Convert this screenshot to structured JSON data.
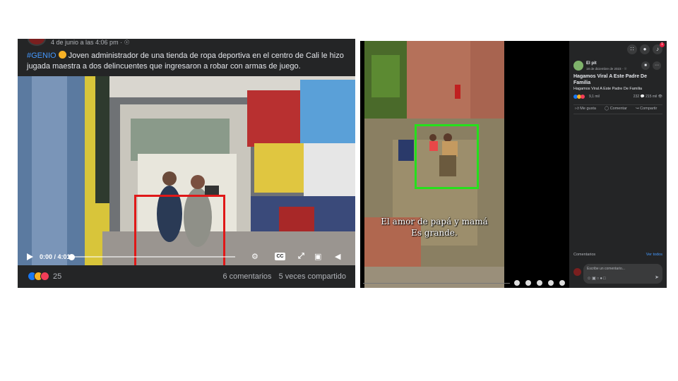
{
  "left_post": {
    "meta": "4 de junio a las 4:06 pm · ",
    "caption_tag": "#GENIO",
    "caption_text": " Joven administrador de una tienda de ropa deportiva en el centro de Cali le hizo jugada maestra a dos delincuentes que ingresaron a robar con armas de juego.",
    "video": {
      "time": "0:00 / 4:01",
      "progress": 0.0,
      "highlight_color": "#e01818",
      "cc_label": "CC"
    },
    "reactions_count": "25",
    "comments": "6 comentarios",
    "shares": "5 veces compartido"
  },
  "right_post": {
    "subtitle_line1": "El amor de papá y mamá",
    "subtitle_line2": "Es grande.",
    "highlight_color": "#25e01c",
    "page_name": "El pit",
    "date": "18 de diciembre de 2023 · ",
    "title": "Hagamos Viral A Este Padre De Familia",
    "subtitle": "Hagamos Viral A Este Padre De Familia",
    "reactions": "9,1 mil",
    "counts": "232 💬   215 mil 👁",
    "actions": {
      "like": "Me gusta",
      "comment": "Comentar",
      "share": "Compartir"
    },
    "comments_header": "Comentarios",
    "see_all": "Ver todos",
    "comment_placeholder": "Escribe un comentario...",
    "notifications_badge": "1"
  },
  "icons": [
    "play-icon",
    "gear-icon",
    "fullscreen-icon",
    "pip-icon",
    "volume-icon",
    "globe-icon",
    "grid-icon",
    "messenger-icon",
    "bell-icon",
    "send-icon"
  ],
  "colors": {
    "fb_blue": "#1877f2",
    "panel_dark": "#242526",
    "link": "#4599ff"
  }
}
